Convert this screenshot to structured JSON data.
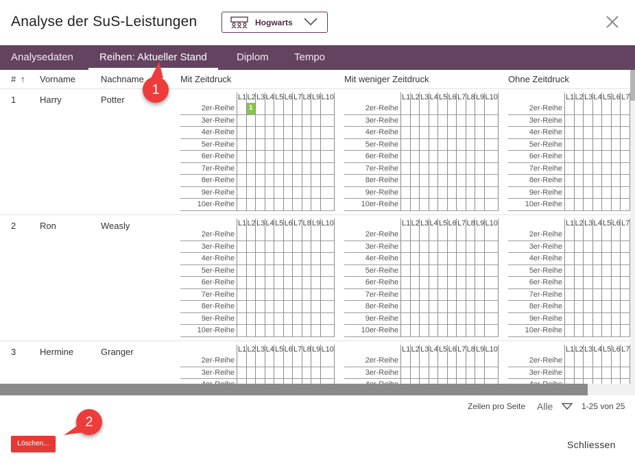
{
  "dialog": {
    "title": "Analyse der SuS-Leistungen",
    "school": "Hogwarts",
    "close_icon": "close-icon"
  },
  "tabs": [
    {
      "label": "Analysedaten"
    },
    {
      "label": "Reihen: Aktueller Stand"
    },
    {
      "label": "Diplom"
    },
    {
      "label": "Tempo"
    }
  ],
  "table": {
    "headers": {
      "num": "#",
      "sort": "↑",
      "first": "Vorname",
      "last": "Nachname",
      "g1": "Mit Zeitdruck",
      "g2": "Mit weniger Zeitdruck",
      "g3": "Ohne Zeitdruck"
    },
    "levels": [
      "L1",
      "L2",
      "L3",
      "L4",
      "L5",
      "L6",
      "L7",
      "L8",
      "L9",
      "L10"
    ],
    "rows_labels": [
      "2er-Reihe",
      "3er-Reihe",
      "4er-Reihe",
      "5er-Reihe",
      "6er-Reihe",
      "7er-Reihe",
      "8er-Reihe",
      "9er-Reihe",
      "10er-Reihe"
    ],
    "students": [
      {
        "num": "1",
        "first": "Harry",
        "last": "Potter",
        "filled": [
          {
            "group": 0,
            "row": 0,
            "level": 1,
            "value": "1"
          }
        ]
      },
      {
        "num": "2",
        "first": "Ron",
        "last": "Weasly",
        "filled": []
      },
      {
        "num": "3",
        "first": "Hermine",
        "last": "Granger",
        "filled": []
      }
    ]
  },
  "pagination": {
    "rows_per_page_label": "Zeilen pro Seite",
    "rows_per_page_value": "Alle",
    "range": "1-25 von 25"
  },
  "footer": {
    "delete_label": "Löschen...",
    "close_label": "Schliessen"
  },
  "callouts": {
    "one": "1",
    "two": "2"
  },
  "colors": {
    "primary": "#634360",
    "filled": "#8bc34a",
    "danger": "#e53935",
    "callout": "#ee3b3b"
  }
}
